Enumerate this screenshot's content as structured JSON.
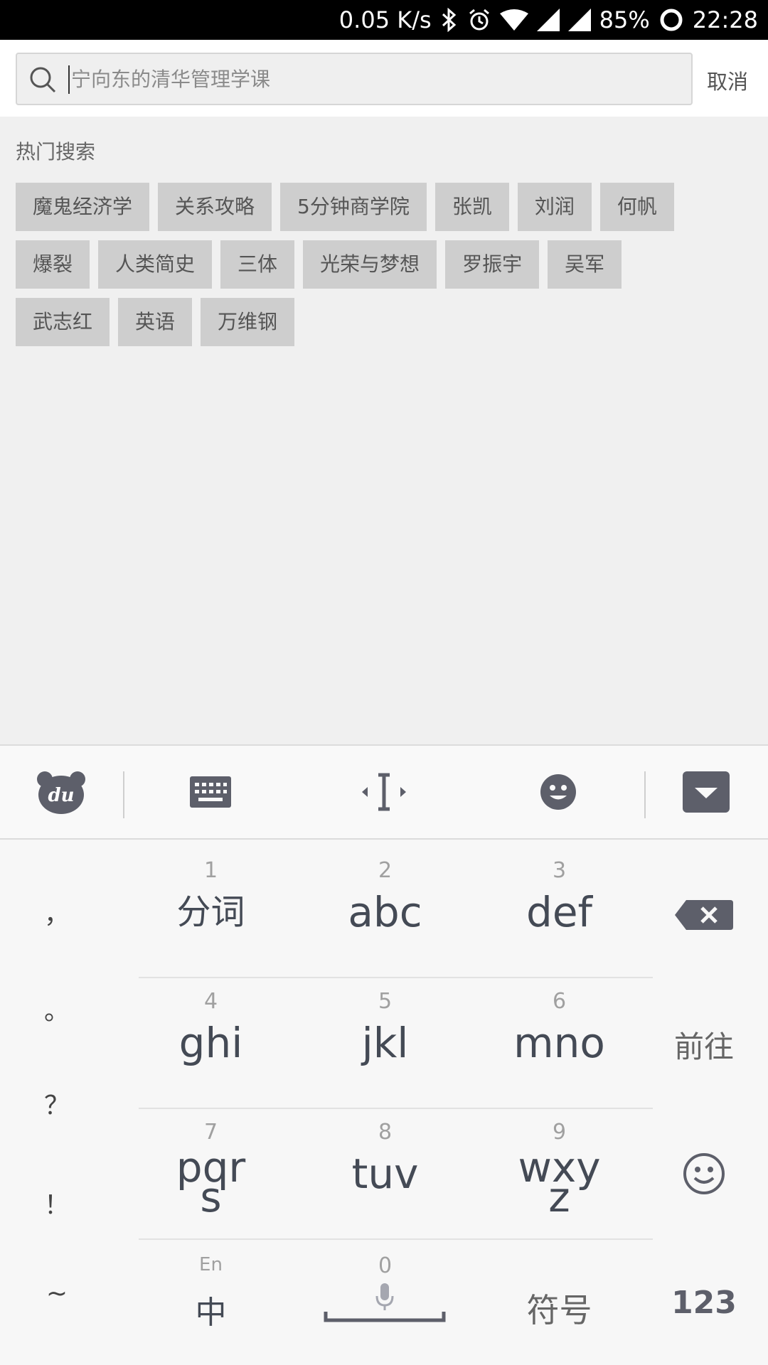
{
  "status_bar": {
    "speed": "0.05 K/s",
    "battery": "85%",
    "time": "22:28",
    "icons": [
      "bluetooth-icon",
      "alarm-icon",
      "wifi-icon",
      "signal-icon",
      "signal-icon",
      "battery-ring-icon"
    ]
  },
  "search": {
    "placeholder": "宁向东的清华管理学课",
    "cancel_label": "取消"
  },
  "hot": {
    "title": "热门搜索",
    "rows": [
      [
        "魔鬼经济学",
        "关系攻略",
        "5分钟商学院",
        "张凯",
        "刘润",
        "何帆"
      ],
      [
        "爆裂",
        "人类简史",
        "三体",
        "光荣与梦想",
        "罗振宇",
        "吴军"
      ],
      [
        "武志红",
        "英语",
        "万维钢"
      ]
    ]
  },
  "toolbar": {
    "items": [
      "du-bear-logo-icon",
      "keyboard-icon",
      "cursor-move-icon",
      "emoji-face-icon",
      "hide-keyboard-icon"
    ],
    "logo_text": "du"
  },
  "keyboard": {
    "side_keys": [
      "，",
      "。",
      "？",
      "！",
      "~"
    ],
    "rows": [
      [
        {
          "num": "1",
          "label": "分词"
        },
        {
          "num": "2",
          "label": "abc"
        },
        {
          "num": "3",
          "label": "def"
        }
      ],
      [
        {
          "num": "4",
          "label": "ghi"
        },
        {
          "num": "5",
          "label": "jkl"
        },
        {
          "num": "6",
          "label": "mno"
        }
      ],
      [
        {
          "num": "7",
          "label": "pqr\ns"
        },
        {
          "num": "8",
          "label": "tuv"
        },
        {
          "num": "9",
          "label": "wxy\nz"
        }
      ]
    ],
    "bottom": {
      "lang_top": "En",
      "lang_label": "中",
      "space_num": "0",
      "symbols_label": "符号",
      "numbers_label": "123"
    },
    "go_label": "前往"
  },
  "colors": {
    "status_bg": "#000000",
    "tag_bg": "#cecece",
    "key_text": "#444a55",
    "icon_dark": "#5d5f6a"
  }
}
